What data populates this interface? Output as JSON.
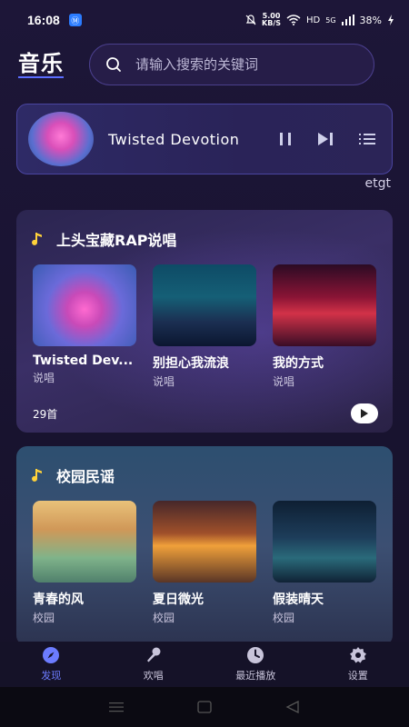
{
  "status_bar": {
    "time": "16:08",
    "app_badge": "Ⓜ",
    "netspeed_value": "5.00",
    "netspeed_unit": "KB/S",
    "hd": "HD",
    "signal": "5G",
    "battery": "38%"
  },
  "header": {
    "logo": "音乐",
    "search_placeholder": "请输入搜索的关键词"
  },
  "now_playing": {
    "title": "Twisted Devotion",
    "user": "etgt"
  },
  "sections": [
    {
      "title": "上头宝藏RAP说唱",
      "count": "29首",
      "cards": [
        {
          "title": "Twisted Dev...",
          "tag": "说唱"
        },
        {
          "title": "别担心我流浪",
          "tag": "说唱"
        },
        {
          "title": "我的方式",
          "tag": "说唱"
        }
      ]
    },
    {
      "title": "校园民谣",
      "cards": [
        {
          "title": "青春的风",
          "tag": "校园"
        },
        {
          "title": "夏日微光",
          "tag": "校园"
        },
        {
          "title": "假装晴天",
          "tag": "校园"
        }
      ]
    }
  ],
  "bottom_nav": [
    {
      "label": "发现",
      "icon": "compass-icon",
      "active": true
    },
    {
      "label": "欢唱",
      "icon": "microphone-icon",
      "active": false
    },
    {
      "label": "最近播放",
      "icon": "clock-icon",
      "active": false
    },
    {
      "label": "设置",
      "icon": "gear-icon",
      "active": false
    }
  ],
  "colors": {
    "accent": "#6c7cff",
    "background": "#1a1433"
  }
}
